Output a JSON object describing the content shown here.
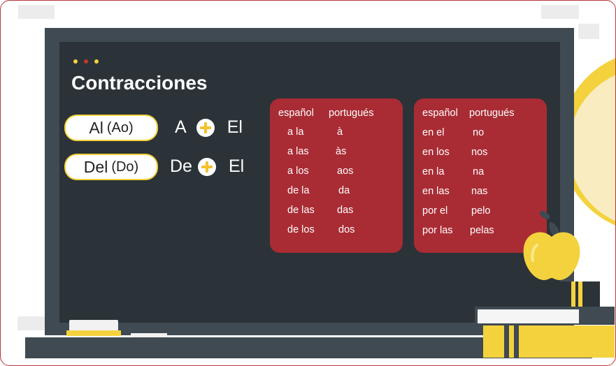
{
  "header": {
    "title": "Contracciones"
  },
  "colors": {
    "board": "#2b3338",
    "frame": "#3f4a52",
    "accent_red": "#a92c34",
    "accent_yellow": "#f4d23e"
  },
  "dots": [
    "#f4d23e",
    "#c0392b",
    "#f4d23e"
  ],
  "contractions": [
    {
      "main": "Al",
      "paren": "(Ao)",
      "left": "A",
      "right": "El",
      "operator_icon": "plus-circle-icon"
    },
    {
      "main": "Del",
      "paren": "(Do)",
      "left": "De",
      "right": "El",
      "operator_icon": "plus-circle-icon"
    }
  ],
  "tables": [
    {
      "headers": [
        "español",
        "portugués"
      ],
      "rows": [
        [
          "a la",
          "à"
        ],
        [
          "a las",
          "às"
        ],
        [
          "a los",
          "aos"
        ],
        [
          "de la",
          "da"
        ],
        [
          "de las",
          "das"
        ],
        [
          "de los",
          "dos"
        ]
      ]
    },
    {
      "headers": [
        "español",
        "portugués"
      ],
      "rows": [
        [
          "en el",
          "no"
        ],
        [
          "en los",
          "nos"
        ],
        [
          "en la",
          "na"
        ],
        [
          "en las",
          "nas"
        ],
        [
          "por el",
          "pelo"
        ],
        [
          "por las",
          "pelas"
        ]
      ]
    }
  ],
  "decor": {
    "apple_icon": "apple-icon",
    "books_icon": "books-icon",
    "chalk_icon": "chalk-icon"
  }
}
